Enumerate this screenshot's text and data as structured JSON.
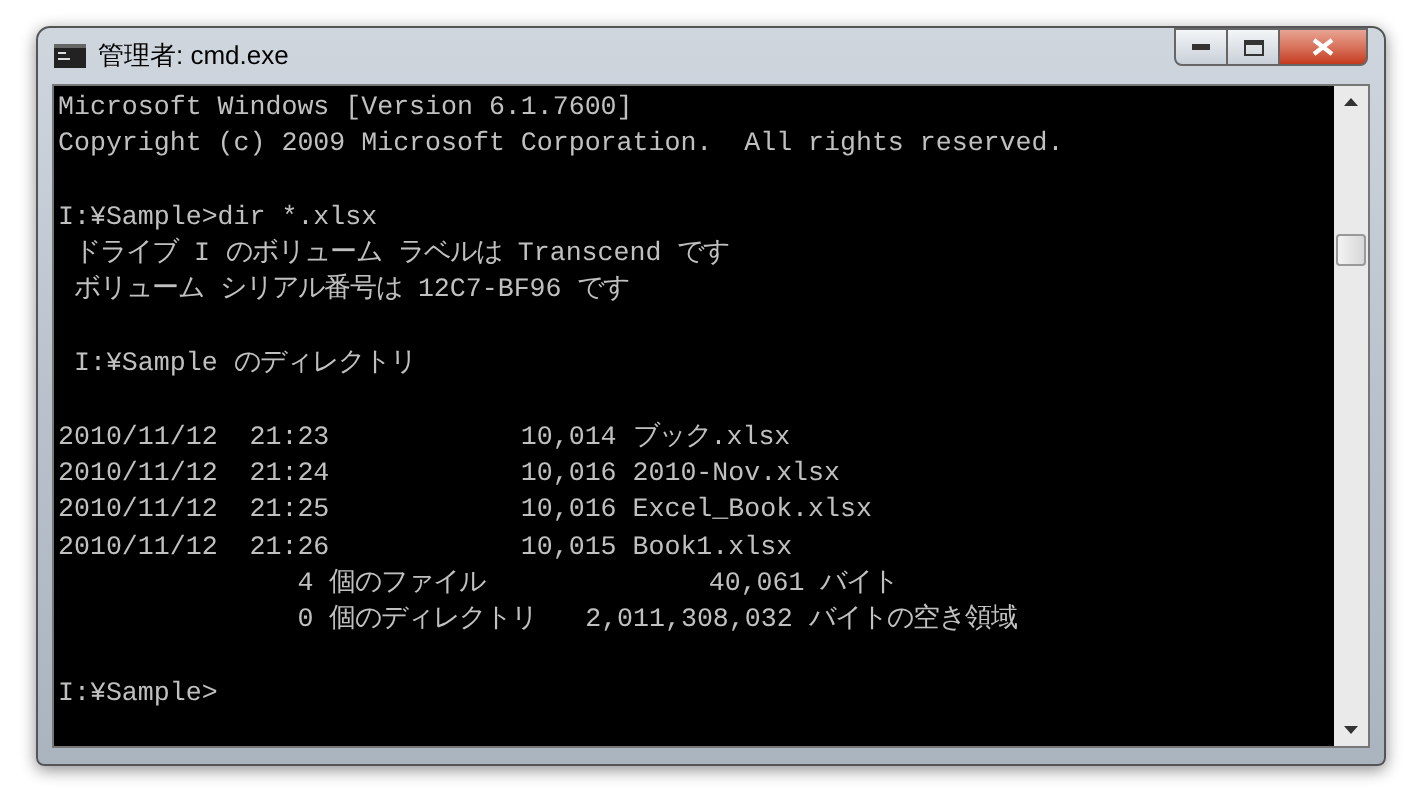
{
  "window": {
    "title": "管理者: cmd.exe"
  },
  "console": {
    "blocks": [
      [
        "Microsoft Windows [Version 6.1.7600]",
        "Copyright (c) 2009 Microsoft Corporation.  All rights reserved."
      ],
      [
        "I:¥Sample>dir *.xlsx",
        " ドライブ I のボリューム ラベルは Transcend です",
        " ボリューム シリアル番号は 12C7-BF96 です"
      ],
      [
        " I:¥Sample のディレクトリ"
      ],
      [
        "2010/11/12  21:23            10,014 ブック.xlsx",
        "2010/11/12  21:24            10,016 2010-Nov.xlsx",
        "2010/11/12  21:25            10,016 Excel_Book.xlsx",
        "2010/11/12  21:26            10,015 Book1.xlsx",
        "               4 個のファイル              40,061 バイト",
        "               0 個のディレクトリ   2,011,308,032 バイトの空き領域"
      ],
      [
        "I:¥Sample>"
      ]
    ]
  }
}
